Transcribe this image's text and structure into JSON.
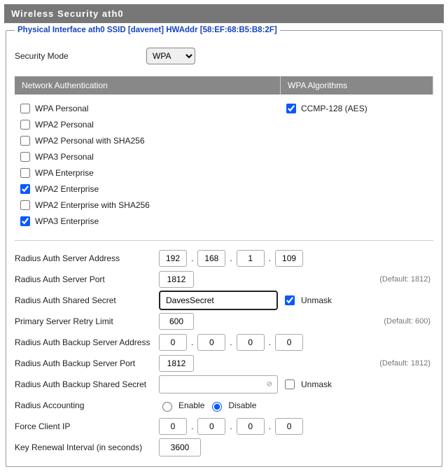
{
  "header": {
    "title": "Wireless Security ath0"
  },
  "legend": "Physical Interface ath0 SSID [davenet] HWAddr [58:EF:68:B5:B8:2F]",
  "security_mode": {
    "label": "Security Mode",
    "value": "WPA"
  },
  "columns": {
    "auth_header": "Network Authentication",
    "algo_header": "WPA Algorithms"
  },
  "auth": {
    "wpa_personal": {
      "label": "WPA Personal",
      "checked": false
    },
    "wpa2_personal": {
      "label": "WPA2 Personal",
      "checked": false
    },
    "wpa2_personal_sha": {
      "label": "WPA2 Personal with SHA256",
      "checked": false
    },
    "wpa3_personal": {
      "label": "WPA3 Personal",
      "checked": false
    },
    "wpa_enterprise": {
      "label": "WPA Enterprise",
      "checked": false
    },
    "wpa2_enterprise": {
      "label": "WPA2 Enterprise",
      "checked": true
    },
    "wpa2_ent_sha": {
      "label": "WPA2 Enterprise with SHA256",
      "checked": false
    },
    "wpa3_enterprise": {
      "label": "WPA3 Enterprise",
      "checked": true
    }
  },
  "algo": {
    "ccmp128": {
      "label": "CCMP-128 (AES)",
      "checked": true
    }
  },
  "radius": {
    "auth_server": {
      "label": "Radius Auth Server Address",
      "oct": [
        "192",
        "168",
        "1",
        "109"
      ]
    },
    "auth_port": {
      "label": "Radius Auth Server Port",
      "value": "1812",
      "default": "(Default: 1812)"
    },
    "auth_secret": {
      "label": "Radius Auth Shared Secret",
      "value": "DavesSecret",
      "unmask_label": "Unmask",
      "unmask_checked": true
    },
    "retry": {
      "label": "Primary Server Retry Limit",
      "value": "600",
      "default": "(Default: 600)"
    },
    "bkp_server": {
      "label": "Radius Auth Backup Server Address",
      "oct": [
        "0",
        "0",
        "0",
        "0"
      ]
    },
    "bkp_port": {
      "label": "Radius Auth Backup Server Port",
      "value": "1812",
      "default": "(Default: 1812)"
    },
    "bkp_secret": {
      "label": "Radius Auth Backup Shared Secret",
      "value": "",
      "unmask_label": "Unmask",
      "unmask_checked": false
    },
    "accounting": {
      "label": "Radius Accounting",
      "enable": "Enable",
      "disable": "Disable",
      "value": "disable"
    },
    "force_ip": {
      "label": "Force Client IP",
      "oct": [
        "0",
        "0",
        "0",
        "0"
      ]
    },
    "key_renewal": {
      "label": "Key Renewal Interval (in seconds)",
      "value": "3600"
    }
  }
}
